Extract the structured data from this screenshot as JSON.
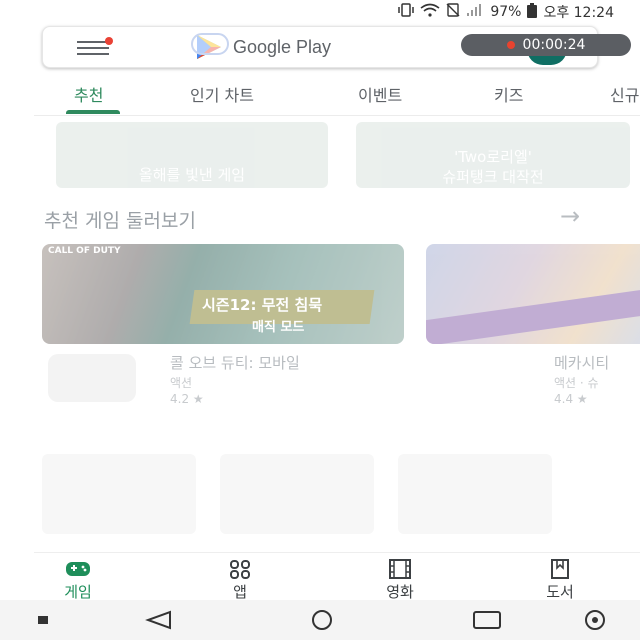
{
  "status_bar": {
    "battery": "97%",
    "time": "오후 12:24",
    "icons": [
      "vibrate-icon",
      "wifi-icon",
      "no-sim-icon",
      "signal-icon",
      "battery-icon"
    ]
  },
  "header": {
    "app_name": "Google Play",
    "menu_icon": "hamburger-menu-icon",
    "recording_timer": "00:00:24"
  },
  "tabs": [
    {
      "label": "추천",
      "active": true
    },
    {
      "label": "인기 차트",
      "active": false
    },
    {
      "label": "이벤트",
      "active": false
    },
    {
      "label": "키즈",
      "active": false
    },
    {
      "label": "신규",
      "active": false
    }
  ],
  "promo_cards": [
    {
      "label": "올해를 빛낸 게임"
    },
    {
      "label_line1": "'Two로리엘'",
      "label_line2": "슈퍼탱크 대작전"
    }
  ],
  "section": {
    "title": "추천 게임 둘러보기",
    "more_icon": "arrow-right-icon"
  },
  "games": [
    {
      "banner_text": "시즌12: 무전 침묵",
      "banner_subtext": "매직 모드",
      "logo_text": "CALL OF DUTY",
      "title": "콜 오브 듀티: 모바일",
      "category": "액션",
      "rating": "4.2 ★"
    },
    {
      "title": "메카시티",
      "category": "액션 · 슈",
      "rating": "4.4 ★"
    }
  ],
  "bottom_nav": [
    {
      "label": "게임",
      "icon": "gamepad-icon",
      "active": true
    },
    {
      "label": "앱",
      "icon": "apps-grid-icon",
      "active": false
    },
    {
      "label": "영화",
      "icon": "film-icon",
      "active": false
    },
    {
      "label": "도서",
      "icon": "book-icon",
      "active": false
    }
  ],
  "colors": {
    "accent": "#1e8e5a",
    "record_dot": "#e8432f"
  }
}
